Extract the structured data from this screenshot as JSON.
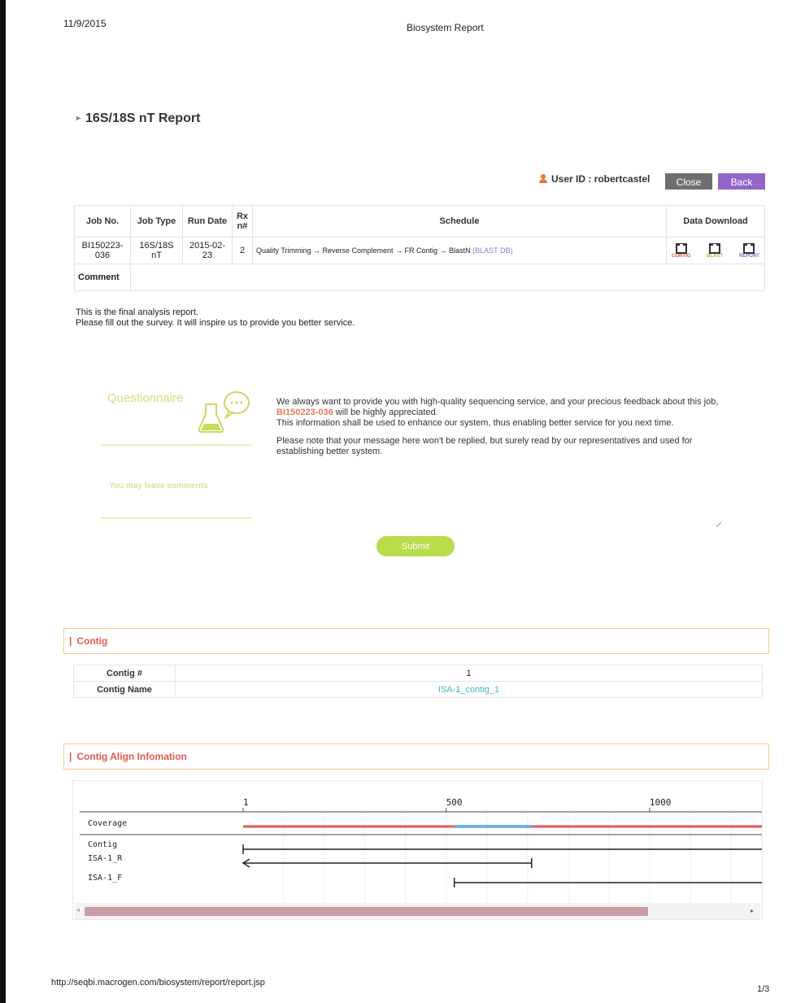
{
  "header": {
    "date": "11/9/2015",
    "title": "Biosystem Report"
  },
  "page_title": "16S/18S nT Report",
  "user": {
    "label": "User ID : robertcastel",
    "icon": "user-icon"
  },
  "buttons": {
    "close": "Close",
    "back": "Back"
  },
  "job_table": {
    "headers": [
      "Job No.",
      "Job Type",
      "Run Date",
      "Rx n#",
      "Schedule",
      "Data Download"
    ],
    "row": {
      "job_no": "BI150223-036",
      "job_type": "16S/18S nT",
      "run_date": "2015-02-23",
      "rxn": "2",
      "schedule": "Quality Trimming → Reverse Complement → FR Contig → BlastN",
      "schedule_db": "(BLAST DB)",
      "downloads": [
        {
          "label": "CONTIG",
          "color": "#d9534f"
        },
        {
          "label": "BLAST",
          "color": "#8cc63f"
        },
        {
          "label": "REPORT",
          "color": "#7b6fbf"
        }
      ]
    },
    "comment_label": "Comment"
  },
  "intro": {
    "line1": "This is the final analysis report.",
    "line2": "Please fill out the survey. It will inspire us to provide you better service."
  },
  "questionnaire": {
    "title": "Questionnaire",
    "p1a": "We always want to provide you with high-quality sequencing service, and your precious feedback about this job,",
    "job": "BI150223-036",
    "p1b": "will be highly appreciated.",
    "p1c": "This information shall be used to enhance our system, thus enabling better service for you next time.",
    "p2": "Please note that your message here won't be replied, but surely read by our representatives and used for establishing better system.",
    "leave": "You may leave comments",
    "submit": "Submit"
  },
  "contig_section": {
    "title": "Contig",
    "rows": [
      {
        "label": "Contig #",
        "value": "1"
      },
      {
        "label": "Contig Name",
        "value": "ISA-1_contig_1"
      }
    ]
  },
  "align_section": {
    "title": "Contig Align Infomation",
    "scale": {
      "min": 1,
      "max": 1280,
      "ticks": [
        1,
        500,
        1000
      ]
    },
    "coverage": {
      "label": "Coverage",
      "start": 1,
      "end": 1280,
      "high_start": 520,
      "high_end": 710
    },
    "tracks": [
      {
        "label": "Contig",
        "start": 1,
        "end": 1280,
        "dir": "plain"
      },
      {
        "label": "ISA-1_R",
        "start": 1,
        "end": 710,
        "dir": "left"
      },
      {
        "label": "ISA-1_F",
        "start": 520,
        "end": 1280,
        "dir": "right"
      }
    ],
    "colors": {
      "coverage": "#e05a5a",
      "high": "#6fb4e0",
      "line": "#222222"
    }
  },
  "footer": {
    "url": "http://seqbi.macrogen.com/biosystem/report/report.jsp",
    "page": "1/3"
  }
}
